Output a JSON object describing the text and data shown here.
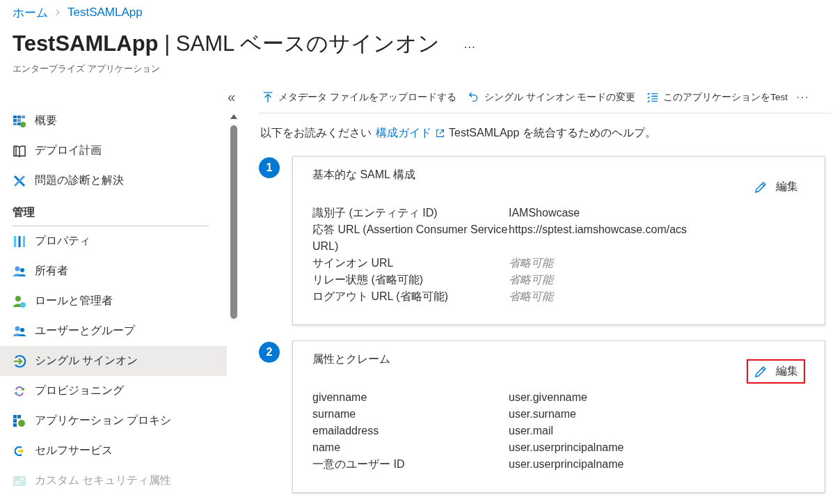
{
  "breadcrumb": [
    {
      "label": "ホーム"
    },
    {
      "label": "TestSAMLApp"
    }
  ],
  "header": {
    "title": "**TestSAMLApp** | SAML ベースのサインオン",
    "more": "…",
    "subtitle": "エンタープライズ アプリケーション"
  },
  "sidebar": {
    "collapse": "«",
    "items": [
      {
        "kind": "item",
        "label": "概要",
        "selected": false,
        "disabled": false
      },
      {
        "kind": "item",
        "label": "デプロイ計画",
        "selected": false,
        "disabled": false
      },
      {
        "kind": "item",
        "label": "問題の診断と解決",
        "selected": false,
        "disabled": false
      },
      {
        "kind": "section",
        "label": "管理"
      },
      {
        "kind": "item",
        "label": "プロパティ",
        "selected": false,
        "disabled": false
      },
      {
        "kind": "item",
        "label": "所有者",
        "selected": false,
        "disabled": false
      },
      {
        "kind": "item",
        "label": "ロールと管理者",
        "selected": false,
        "disabled": false
      },
      {
        "kind": "item",
        "label": "ユーザーとグループ",
        "selected": false,
        "disabled": false
      },
      {
        "kind": "item",
        "label": "シングル サインオン",
        "selected": true,
        "disabled": false
      },
      {
        "kind": "item",
        "label": "プロビジョニング",
        "selected": false,
        "disabled": false
      },
      {
        "kind": "item",
        "label": "アプリケーション プロキシ",
        "selected": false,
        "disabled": false
      },
      {
        "kind": "item",
        "label": "セルフサービス",
        "selected": false,
        "disabled": false
      },
      {
        "kind": "item",
        "label": "カスタム セキュリティ属性",
        "selected": false,
        "disabled": true
      }
    ]
  },
  "toolbar": {
    "buttons": [
      {
        "label": "メタデータ ファイルをアップロードする"
      },
      {
        "label": "シングル サインオン モードの変更"
      },
      {
        "label": "このアプリケーションをTest"
      }
    ],
    "more": "···"
  },
  "intro": {
    "before": "以下をお読みください",
    "link": "構成ガイド",
    "after": "TestSAMLApp を統合するためのヘルプ。"
  },
  "steps": [
    {
      "number": "1",
      "title": "基本的な SAML 構成",
      "edit": {
        "label": "編集",
        "highlighted": false
      },
      "rows": [
        {
          "label": "識別子 (エンティティ ID)",
          "value": "IAMShowcase",
          "muted": false
        },
        {
          "label": "応答 URL (Assertion Consumer Service URL)",
          "value": "https://sptest.iamshowcase.com/acs",
          "muted": false
        },
        {
          "label": "サインオン URL",
          "value": "省略可能",
          "muted": true
        },
        {
          "label": "リレー状態 (省略可能)",
          "value": "省略可能",
          "muted": true
        },
        {
          "label": "ログアウト URL (省略可能)",
          "value": "省略可能",
          "muted": true
        }
      ]
    },
    {
      "number": "2",
      "title": "属性とクレーム",
      "edit": {
        "label": "編集",
        "highlighted": true
      },
      "rows": [
        {
          "label": "givenname",
          "value": "user.givenname",
          "muted": false
        },
        {
          "label": "surname",
          "value": "user.surname",
          "muted": false
        },
        {
          "label": "emailaddress",
          "value": "user.mail",
          "muted": false
        },
        {
          "label": "name",
          "value": "user.userprincipalname",
          "muted": false
        },
        {
          "label": "一意のユーザー ID",
          "value": "user.userprincipalname",
          "muted": false
        }
      ]
    }
  ]
}
